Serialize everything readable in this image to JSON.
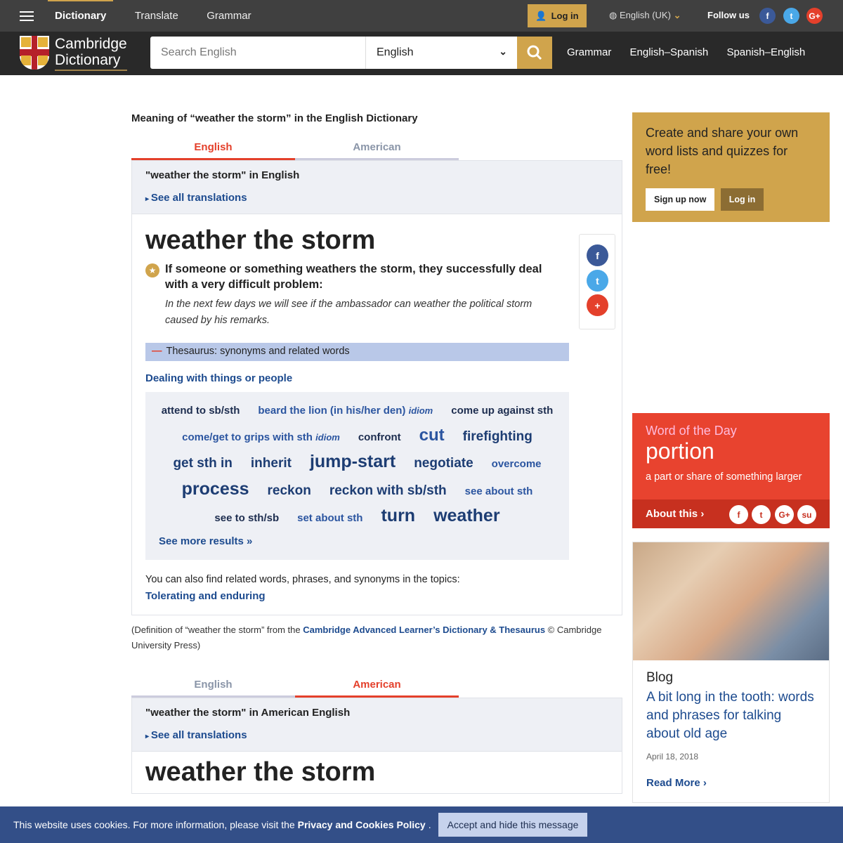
{
  "topbar": {
    "nav": [
      "Dictionary",
      "Translate",
      "Grammar"
    ],
    "login": "Log in",
    "language": "English (UK)",
    "follow": "Follow us"
  },
  "header": {
    "logo": [
      "Cambridge",
      "Dictionary"
    ],
    "search_placeholder": "Search English",
    "dict_select": "English",
    "nav": [
      "Grammar",
      "English–Spanish",
      "Spanish–English"
    ]
  },
  "main": {
    "meaning_title": "Meaning of “weather the storm” in the English Dictionary",
    "tabs": [
      "English",
      "American"
    ],
    "translations": {
      "heading": "\"weather the storm\" in English",
      "link": "See all translations"
    },
    "headword": "weather the storm",
    "definition": "If someone or something weathers the storm, they successfully deal with a very difficult problem:",
    "example": "In the next few days we will see if the ambassador can weather the political storm caused by his remarks.",
    "thesaurus": "Thesaurus: synonyms and related words",
    "category": "Dealing with things or people",
    "words": [
      {
        "t": "attend to sb/sth"
      },
      {
        "t": "beard the lion (in his/her den)",
        "tag": "idiom"
      },
      {
        "t": "come up against sth"
      },
      {
        "t": "come/get to grips with sth",
        "tag": "idiom"
      },
      {
        "t": "confront"
      },
      {
        "t": "cut"
      },
      {
        "t": "firefighting"
      },
      {
        "t": "get sth in"
      },
      {
        "t": "inherit"
      },
      {
        "t": "jump-start"
      },
      {
        "t": "negotiate"
      },
      {
        "t": "overcome"
      },
      {
        "t": "process"
      },
      {
        "t": "reckon"
      },
      {
        "t": "reckon with sb/sth"
      },
      {
        "t": "see about sth"
      },
      {
        "t": "see to sth/sb"
      },
      {
        "t": "set about sth"
      },
      {
        "t": "turn"
      },
      {
        "t": "weather"
      }
    ],
    "see_more": "See more results »",
    "topics_text": "You can also find related words, phrases, and synonyms in the topics:",
    "topic_link": "Tolerating and enduring",
    "source_pre": "(Definition of “weather the storm” from the ",
    "source_link": "Cambridge Advanced Learner’s Dictionary & Thesaurus",
    "source_post": " © Cambridge University Press)",
    "american": {
      "heading": "\"weather the storm\" in American English",
      "link": "See all translations",
      "headword": "weather the storm"
    }
  },
  "sidebar": {
    "promo": {
      "text": "Create and share your own word lists and quizzes for free!",
      "signup": "Sign up now",
      "login": "Log in"
    },
    "wotd": {
      "label": "Word of the Day",
      "word": "portion",
      "definition": "a part or share of something larger",
      "about": "About this"
    },
    "blog": {
      "label": "Blog",
      "title": "A bit long in the tooth: words and phrases for talking about old age",
      "date": "April 18, 2018",
      "read_more": "Read More"
    }
  },
  "cookie": {
    "text": "This website uses cookies. For more information, please visit the",
    "link": "Privacy and Cookies Policy",
    "button": "Accept and hide this message"
  },
  "colors": {
    "accent": "#d0a44c",
    "red": "#e4402b",
    "link": "#1d4b8f"
  }
}
